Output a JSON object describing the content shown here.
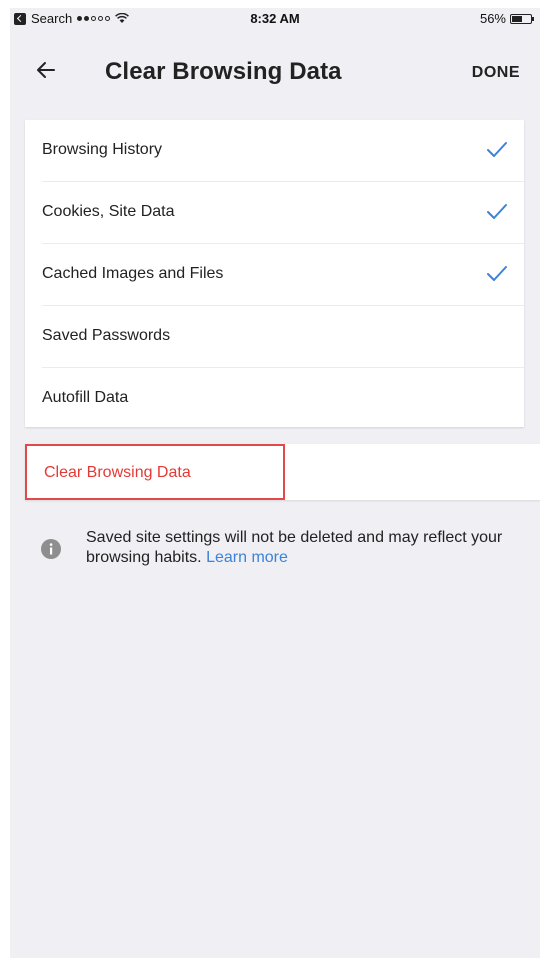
{
  "status_bar": {
    "back_app": "Search",
    "time": "8:32 AM",
    "battery": "56%",
    "battery_level": 0.56
  },
  "header": {
    "title": "Clear Browsing Data",
    "done": "DONE"
  },
  "options": [
    {
      "label": "Browsing History",
      "checked": true
    },
    {
      "label": "Cookies, Site Data",
      "checked": true
    },
    {
      "label": "Cached Images and Files",
      "checked": true
    },
    {
      "label": "Saved Passwords",
      "checked": false
    },
    {
      "label": "Autofill Data",
      "checked": false
    }
  ],
  "clear_button": {
    "label": "Clear Browsing Data"
  },
  "note": {
    "text": "Saved site settings will not be deleted and may reflect your browsing habits.",
    "link": "Learn more"
  },
  "colors": {
    "accent": "#3b82d8",
    "danger": "#e53935",
    "background": "#efeff4"
  },
  "icons": {
    "back": "arrow-left-icon",
    "check": "checkmark-icon",
    "info": "info-icon"
  }
}
